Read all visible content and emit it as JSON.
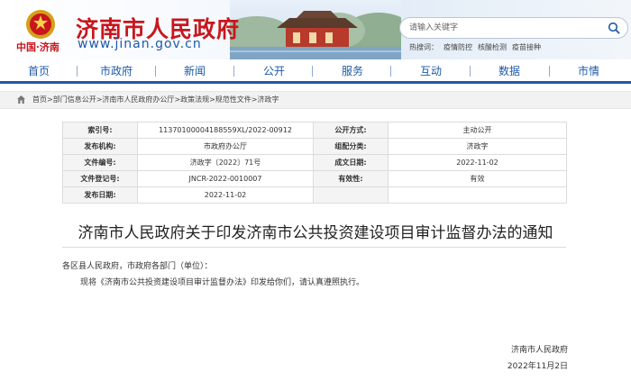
{
  "header": {
    "site_title": "济南市人民政府",
    "site_url": "www.jinan.gov.cn",
    "brand_small": "中国·济南",
    "search_placeholder": "请输入关键字",
    "hot_label": "热搜词：",
    "hot_words": [
      "疫情防控",
      "核酸检测",
      "疫苗接种"
    ]
  },
  "nav": {
    "items": [
      "首页",
      "市政府",
      "新闻",
      "公开",
      "服务",
      "互动",
      "数据",
      "市情"
    ]
  },
  "breadcrumb": {
    "path": "首页>部门信息公开>济南市人民政府办公厅>政策法规>规范性文件>济政字"
  },
  "meta": {
    "rows": [
      [
        "索引号:",
        "11370100004188559XL/2022-00912",
        "公开方式:",
        "主动公开"
      ],
      [
        "发布机构:",
        "市政府办公厅",
        "组配分类:",
        "济政字"
      ],
      [
        "文件编号:",
        "济政字〔2022〕71号",
        "成文日期:",
        "2022-11-02"
      ],
      [
        "文件登记号:",
        "JNCR-2022-0010007",
        "有效性:",
        "有效"
      ],
      [
        "发布日期:",
        "2022-11-02",
        "",
        ""
      ]
    ]
  },
  "article": {
    "title": "济南市人民政府关于印发济南市公共投资建设项目审计监督办法的通知",
    "salutation": "各区县人民政府，市政府各部门（单位）：",
    "body": "现将《济南市公共投资建设项目审计监督办法》印发给你们，请认真遵照执行。",
    "signature": "济南市人民政府",
    "date": "2022年11月2日"
  },
  "colors": {
    "brand_red": "#c8161d",
    "brand_blue": "#1d5aa8"
  }
}
